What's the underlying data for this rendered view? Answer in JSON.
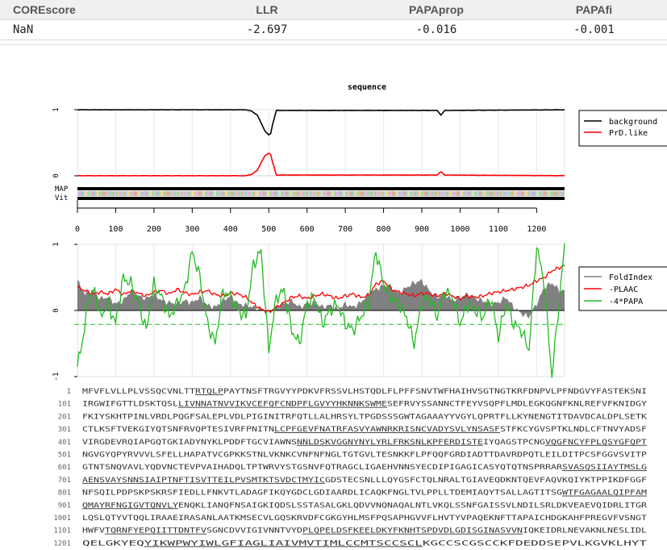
{
  "scores": {
    "headers": [
      "COREscore",
      "LLR",
      "PAPAprop",
      "PAPAfi"
    ],
    "values": [
      "NaN",
      "-2.697",
      "-0.016",
      "-0.001"
    ]
  },
  "chart_data": [
    {
      "type": "line",
      "title": "sequence",
      "x_range": [
        0,
        1273
      ],
      "y_ticks": [
        "0",
        "1"
      ],
      "ylim": [
        0,
        1
      ],
      "legend": {
        "position": "right",
        "entries": [
          {
            "name": "background",
            "color": "#000000"
          },
          {
            "name": "PrD.like",
            "color": "#ff0000"
          }
        ]
      },
      "series": [
        {
          "name": "background",
          "x": [
            0,
            440,
            455,
            470,
            480,
            490,
            500,
            505,
            510,
            520,
            940,
            950,
            960,
            1273
          ],
          "values": [
            1,
            1,
            0.98,
            0.92,
            0.8,
            0.68,
            0.62,
            0.64,
            0.78,
            0.99,
            0.99,
            0.92,
            0.99,
            1
          ]
        },
        {
          "name": "PrD.like",
          "x": [
            0,
            440,
            455,
            470,
            480,
            490,
            500,
            505,
            510,
            520,
            940,
            950,
            960,
            1273
          ],
          "values": [
            0,
            0,
            0.02,
            0.08,
            0.2,
            0.3,
            0.34,
            0.32,
            0.2,
            0.01,
            0.01,
            0.06,
            0.01,
            0
          ]
        }
      ],
      "tracks": [
        "MAP",
        "Vit"
      ]
    },
    {
      "type": "line",
      "x_ticks": [
        "0",
        "100",
        "200",
        "300",
        "400",
        "500",
        "600",
        "700",
        "800",
        "900",
        "1000",
        "1100",
        "1200"
      ],
      "x_tick_values": [
        0,
        100,
        200,
        300,
        400,
        500,
        600,
        700,
        800,
        900,
        1000,
        1100,
        1200
      ],
      "y_ticks": [
        "-1",
        "0",
        "1"
      ],
      "ylim": [
        -1,
        1
      ],
      "threshold": -0.21,
      "legend": {
        "position": "right",
        "entries": [
          {
            "name": "FoldIndex",
            "color": "#808080"
          },
          {
            "name": "-PLAAC",
            "color": "#ff0000"
          },
          {
            "name": "-4*PAPA",
            "color": "#22bb22"
          }
        ]
      },
      "series": [
        {
          "name": "FoldIndex",
          "x": [
            0,
            20,
            40,
            60,
            80,
            100,
            120,
            140,
            160,
            180,
            200,
            220,
            240,
            260,
            280,
            300,
            320,
            340,
            360,
            380,
            400,
            420,
            440,
            460,
            480,
            500,
            520,
            540,
            560,
            580,
            600,
            620,
            640,
            660,
            680,
            700,
            720,
            740,
            760,
            780,
            800,
            820,
            840,
            860,
            880,
            900,
            920,
            940,
            960,
            980,
            1000,
            1020,
            1040,
            1060,
            1080,
            1100,
            1120,
            1140,
            1160,
            1180,
            1200,
            1220,
            1240,
            1260,
            1273
          ],
          "values": [
            0.45,
            0.25,
            0.3,
            0.18,
            0.2,
            0.1,
            0.15,
            0.3,
            0.22,
            0.18,
            0.25,
            0.15,
            0.12,
            0.1,
            0.15,
            0.12,
            0.2,
            0.08,
            0.05,
            0.15,
            0.22,
            0.1,
            0.08,
            0.05,
            0.02,
            -0.05,
            0.05,
            0.1,
            0.15,
            0.05,
            0.1,
            0.12,
            0.05,
            0.08,
            0.02,
            0.1,
            0.05,
            0.12,
            0.25,
            0.32,
            0.38,
            0.36,
            0.25,
            0.35,
            0.42,
            0.45,
            0.3,
            0.2,
            0.25,
            0.15,
            0.2,
            0.25,
            0.18,
            0.15,
            0.1,
            0.12,
            0.2,
            0.05,
            -0.05,
            -0.1,
            0.1,
            0.35,
            0.42,
            0.3,
            0.3
          ]
        },
        {
          "name": "-PLAAC",
          "x": [
            0,
            20,
            40,
            60,
            80,
            100,
            120,
            140,
            160,
            180,
            200,
            220,
            240,
            260,
            280,
            300,
            320,
            340,
            360,
            380,
            400,
            420,
            440,
            460,
            480,
            500,
            520,
            540,
            560,
            580,
            600,
            620,
            640,
            660,
            680,
            700,
            720,
            740,
            760,
            780,
            800,
            820,
            840,
            860,
            880,
            900,
            920,
            940,
            960,
            980,
            1000,
            1020,
            1040,
            1060,
            1080,
            1100,
            1120,
            1140,
            1160,
            1180,
            1200,
            1220,
            1240,
            1260,
            1273
          ],
          "values": [
            0.35,
            0.3,
            0.25,
            0.28,
            0.25,
            0.32,
            0.24,
            0.3,
            0.26,
            0.22,
            0.28,
            0.3,
            0.25,
            0.32,
            0.27,
            0.24,
            0.28,
            0.3,
            0.24,
            0.22,
            0.26,
            0.25,
            0.2,
            0.1,
            0.02,
            -0.02,
            0.05,
            0.12,
            0.2,
            0.22,
            0.18,
            0.22,
            0.25,
            0.22,
            0.18,
            0.22,
            0.25,
            0.2,
            0.22,
            0.4,
            0.45,
            0.32,
            0.28,
            0.25,
            0.22,
            0.26,
            0.25,
            0.22,
            0.26,
            0.22,
            0.18,
            0.22,
            0.2,
            0.22,
            0.26,
            0.28,
            0.3,
            0.32,
            0.35,
            0.38,
            0.45,
            0.5,
            0.6,
            0.65,
            0.68
          ]
        },
        {
          "name": "-4*PAPA",
          "x": [
            0,
            15,
            30,
            45,
            60,
            80,
            100,
            120,
            140,
            160,
            180,
            200,
            220,
            240,
            260,
            280,
            300,
            320,
            340,
            360,
            380,
            400,
            420,
            440,
            460,
            480,
            500,
            520,
            540,
            560,
            580,
            600,
            620,
            640,
            660,
            680,
            700,
            720,
            740,
            760,
            780,
            800,
            820,
            840,
            860,
            880,
            900,
            920,
            940,
            960,
            980,
            1000,
            1020,
            1040,
            1060,
            1080,
            1100,
            1120,
            1140,
            1160,
            1180,
            1200,
            1220,
            1240,
            1260,
            1273
          ],
          "values": [
            -0.85,
            -0.4,
            0.2,
            0.3,
            -0.1,
            0.1,
            -0.2,
            0.5,
            0.4,
            0.1,
            -0.3,
            0.4,
            0.2,
            -0.1,
            0.1,
            0.3,
            0.9,
            0.5,
            -0.2,
            -0.5,
            0.3,
            0.2,
            0.0,
            -0.1,
            0.7,
            0.9,
            -0.6,
            0.2,
            0.3,
            -0.3,
            -0.5,
            0.1,
            0.2,
            -0.2,
            0.0,
            0.1,
            -0.2,
            -0.3,
            -0.1,
            0.1,
            0.9,
            0.4,
            0.2,
            0.1,
            -0.1,
            -0.5,
            0.1,
            0.2,
            -0.1,
            0.3,
            0.2,
            -0.2,
            0.1,
            0.0,
            -0.1,
            0.2,
            -0.4,
            0.1,
            -0.2,
            -0.3,
            -0.6,
            0.98,
            0.4,
            -1.0,
            0.2,
            0.98
          ]
        }
      ]
    }
  ],
  "sequence": {
    "lines": [
      {
        "num": "1",
        "segs": [
          [
            "MFVFLVLLPLVSSQCVNLTT",
            false
          ],
          [
            "RTQLP",
            true
          ],
          [
            "PAYTNSFTRGVYYPDKVFRSSVLHSTQDLFLPFFSNVTWFHAIHVSGTNGTKRFDNPVLPFNDGVYFASTEKSNI",
            false
          ]
        ]
      },
      {
        "num": "101",
        "segs": [
          [
            "IRGWIFGTTLDSKTQSL",
            false
          ],
          [
            "LIVNNATNVVIKVCEFQFCNDPFLGVYYHKNNKSWME",
            true
          ],
          [
            "SEFRVYSSANNCTFEYVSQPFLMDLEGKQGNFKNLREFVFKNIDGY",
            false
          ]
        ]
      },
      {
        "num": "201",
        "segs": [
          [
            "FKIYSKHTPINLVRDLPQGFSALEPLVDLPIGINITRFQTLLALHRSYLTPGDSSSGWTAGAAAYYVGYLQPRTFLLKYNENGTITDAVDCALDPLSETK",
            false
          ]
        ]
      },
      {
        "num": "301",
        "segs": [
          [
            "CTLKSFTVEKGIYQTSNFRVQPTESIVRFPNITN",
            false
          ],
          [
            "LCPFGEVFNATRFASVYAWNRKRISNCVADYSVLYNSASF",
            true
          ],
          [
            "STFKCYGVSPTKLNDLCFTNVYADSF",
            false
          ]
        ]
      },
      {
        "num": "401",
        "segs": [
          [
            "VIRGDEVRQIAPGQTGKIADYNYKLPDDFTGCVIAWNS",
            false
          ],
          [
            "NNLDSKVGGNYNYLYRLFRKSNLKPFERDISTE",
            true
          ],
          [
            "IYQAGSTPCNG",
            false
          ],
          [
            "VQGFNCYFPLQSYGFQPT",
            true
          ]
        ]
      },
      {
        "num": "501",
        "segs": [
          [
            "NGVGYQPYRVVVLSFELLHAPATVCGPKKSTNLVKNKCVNFNFNGLTGTGVLTESNKKFLPFQQFGRDIADTTDAVRDPQTLEILDITPCSFGGVSVITP",
            false
          ]
        ]
      },
      {
        "num": "601",
        "segs": [
          [
            "GTNTSNQVAVLYQDVNCTEVPVAIHADQLTPTWRVYSTGSNVFQTRAGCLIGAEHVNNSYECDIPIGAGICASYQTQTNSPRRAR",
            false
          ],
          [
            "SVASQSIIAYTMSLG",
            true
          ]
        ]
      },
      {
        "num": "701",
        "segs": [
          [
            "AENSVAYSNNSIAIPTNFTISVTTEILPVSMTKTSVDCTMYIC",
            true
          ],
          [
            "GDSTECSNLLLQYGSFCTQLNRALTGIAVEQDKNTQEVFAQVKQIYKTPPIKDFGGF",
            false
          ]
        ]
      },
      {
        "num": "801",
        "segs": [
          [
            "NFSQILPDPSKPSKRSFIEDLLFNKVTLADAGFIKQYGDCLGDIAARDLICAQKFNGLTVLPPLLTDEMIAQYTSALLAGTITSG",
            false
          ],
          [
            "WTFGAGAALQIPFAM",
            true
          ]
        ]
      },
      {
        "num": "901",
        "segs": [
          [
            "QMAYRFNGIGVTQNVLY",
            true
          ],
          [
            "ENQKLIANQFNSAIGKIQDSLSSTASALGKLQDVVNQNAQALNTLVKQLSSNFGAISSVLNDILSRLDKVEAEVQIDRLITGR",
            false
          ]
        ]
      },
      {
        "num": "1001",
        "segs": [
          [
            "LQSLQTYVTQQLIRAAEIRASANLAATKMSECVLGQSKRVDFCGKGYHLMSFPQSAPHGVVFLHVTYVPAQEKNFTTAPAICHDGKAHFPREGVFVSNGT",
            false
          ]
        ]
      },
      {
        "num": "1101",
        "segs": [
          [
            "HWFV",
            false
          ],
          [
            "TQRNFYEPQIITTDNTFV",
            true
          ],
          [
            "SGNCDVVIGIVNNTVYD",
            false
          ],
          [
            "PLQPELDSFKEELDKYFKNHTSPDVDLGDISGINASVVN",
            true
          ],
          [
            "IQKEIDRLNEVAKNLNESLIDL",
            false
          ]
        ]
      },
      {
        "num": "1201",
        "segs": [
          [
            "QELGKYEQ",
            false
          ],
          [
            "YIKWPWYIWLGFIAGLIAIVMVTIMLCCMTSCCSCL",
            true
          ],
          [
            "KGCCSCGSCCKFDEDDSEPVLKGVKLHYT",
            false
          ]
        ]
      }
    ]
  }
}
